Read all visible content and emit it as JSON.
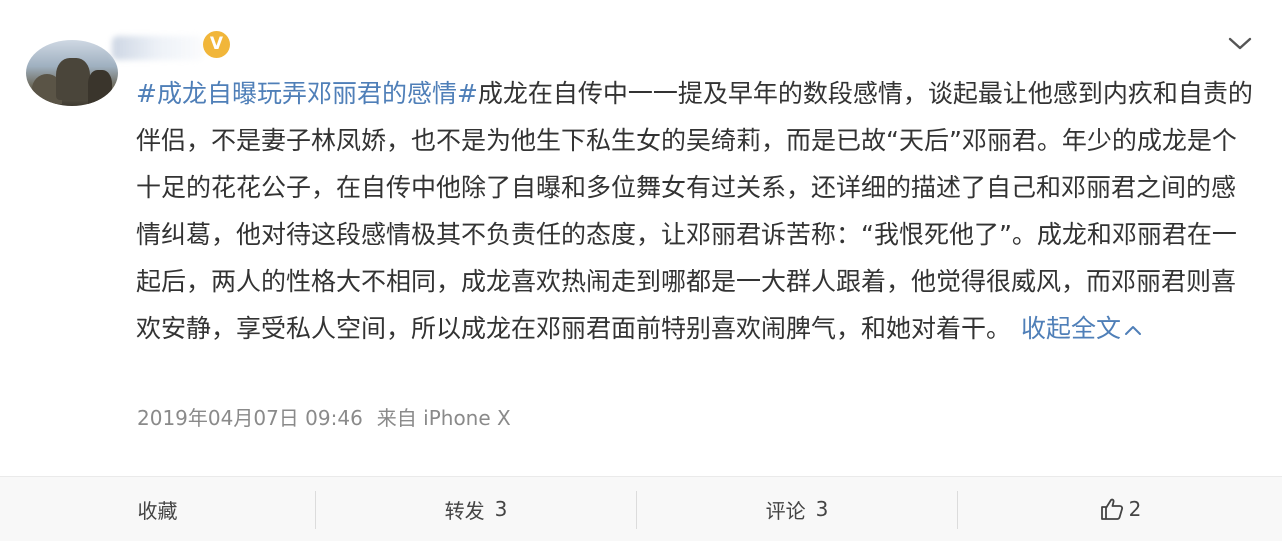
{
  "post": {
    "topic": "#成龙自曝玩弄邓丽君的感情#",
    "body": "成龙在自传中一一提及早年的数段感情，谈起最让他感到内疚和自责的伴侣，不是妻子林凤娇，也不是为他生下私生女的吴绮莉，而是已故“天后”邓丽君。年少的成龙是个十足的花花公子，在自传中他除了自曝和多位舞女有过关系，还详细的描述了自己和邓丽君之间的感情纠葛，他对待这段感情极其不负责任的态度，让邓丽君诉苦称：“我恨死他了”。成龙和邓丽君在一起后，两人的性格大不相同，成龙喜欢热闹走到哪都是一大群人跟着，他觉得很威风，而邓丽君则喜欢安静，享受私人空间，所以成龙在邓丽君面前特别喜欢闹脾气，和她对着干。",
    "collapse_label": "收起全文",
    "timestamp": "2019年04月07日 09:46",
    "source": "来自 iPhone X",
    "verified_mark": "V"
  },
  "actions": {
    "favorite_label": "收藏",
    "repost_label": "转发",
    "repost_count": "3",
    "comment_label": "评论",
    "comment_count": "3",
    "like_count": "2"
  },
  "colors": {
    "link": "#4f7fb8",
    "text": "#333333",
    "meta": "#8a8a8a",
    "verified": "#f1b63a",
    "action_bar_bg": "#f8f8f8"
  },
  "icons": {
    "menu": "chevron-down-icon",
    "collapse": "chevron-up-icon",
    "like": "thumbs-up-icon",
    "verified": "verified-badge-icon"
  }
}
